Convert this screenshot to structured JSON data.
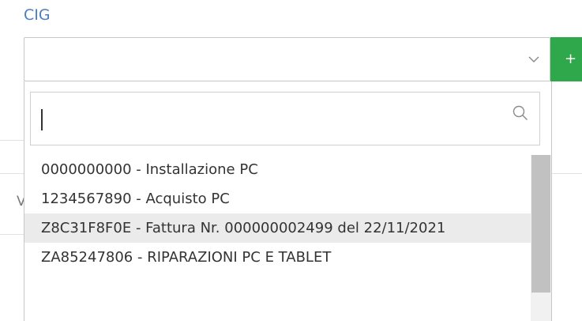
{
  "field": {
    "label": "CIG",
    "selected_value": "",
    "add_button_label": "+"
  },
  "background": {
    "partial_text": "V"
  },
  "dropdown": {
    "search_value": "",
    "options": [
      {
        "label": "0000000000 - Installazione PC",
        "highlighted": false
      },
      {
        "label": "1234567890 - Acquisto PC",
        "highlighted": false
      },
      {
        "label": "Z8C31F8F0E - Fattura Nr. 000000002499 del 22/11/2021",
        "highlighted": true
      },
      {
        "label": "ZA85247806 - RIPARAZIONI PC E TABLET",
        "highlighted": false
      }
    ]
  },
  "icons": {
    "chevron": "chevron-down-icon",
    "search": "search-icon"
  },
  "colors": {
    "label": "#4a7fc1",
    "add_button": "#2ea84a",
    "highlight": "#ebebeb",
    "scroll_thumb": "#c1c1c1"
  }
}
